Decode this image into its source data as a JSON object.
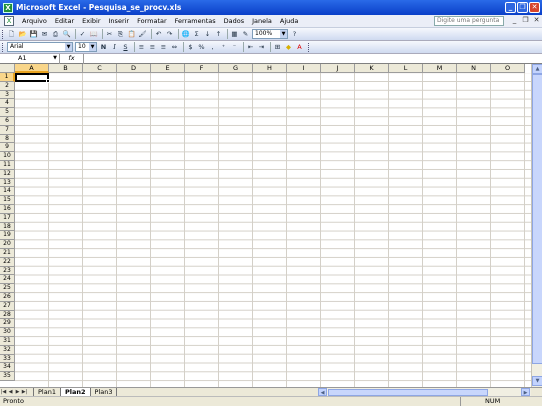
{
  "window": {
    "title": "Microsoft Excel - Pesquisa_se_procv.xls"
  },
  "menu": [
    "Arquivo",
    "Editar",
    "Exibir",
    "Inserir",
    "Formatar",
    "Ferramentas",
    "Dados",
    "Janela",
    "Ajuda"
  ],
  "help_box": {
    "placeholder": "Digite uma pergunta"
  },
  "toolbar": {
    "zoom": "100%",
    "font_name": "Arial",
    "font_size": "10",
    "bold": "N",
    "italic": "I",
    "underline": "S",
    "sigma": "Σ"
  },
  "formula_bar": {
    "name_box": "A1",
    "fx": "fx",
    "value": ""
  },
  "grid": {
    "columns": [
      "A",
      "B",
      "C",
      "D",
      "E",
      "F",
      "G",
      "H",
      "I",
      "J",
      "K",
      "L",
      "M",
      "N",
      "O"
    ],
    "rows": [
      "1",
      "2",
      "3",
      "4",
      "5",
      "6",
      "7",
      "8",
      "9",
      "10",
      "11",
      "12",
      "13",
      "14",
      "15",
      "16",
      "17",
      "18",
      "19",
      "20",
      "21",
      "22",
      "23",
      "24",
      "25",
      "26",
      "27",
      "28",
      "29",
      "30",
      "31",
      "32",
      "33",
      "34",
      "35"
    ],
    "active_cell": "A1"
  },
  "sheets": [
    {
      "label": "Plan1"
    },
    {
      "label": "Plan2"
    },
    {
      "label": "Plan3"
    }
  ],
  "active_sheet": "Plan2",
  "status": {
    "left": "Pronto",
    "num": "NUM"
  },
  "colors": {
    "title_bar": "#0a3fc8",
    "menu_bg": "#ebeef7",
    "selected_header": "#f9d68a"
  }
}
